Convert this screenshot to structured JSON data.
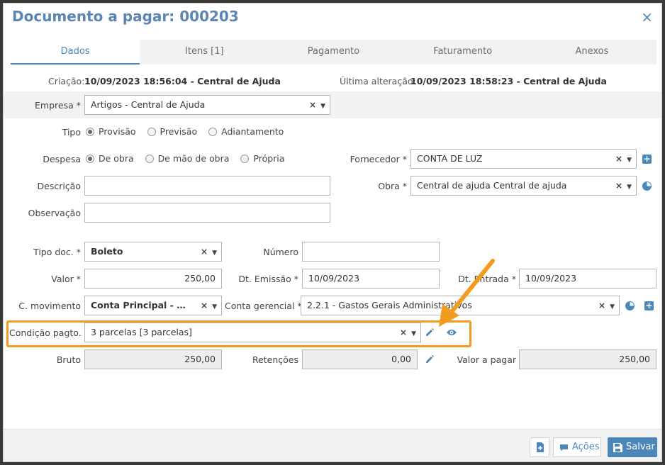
{
  "header": {
    "title": "Documento a pagar: 000203",
    "close_glyph": "×"
  },
  "tabs": [
    {
      "label": "Dados",
      "active": true
    },
    {
      "label": "Itens [1]"
    },
    {
      "label": "Pagamento"
    },
    {
      "label": "Faturamento"
    },
    {
      "label": "Anexos"
    }
  ],
  "meta": {
    "creation_label": "Criação:",
    "creation_value": "10/09/2023 18:56:04 - Central de Ajuda",
    "lastmod_label": "Última alteração:",
    "lastmod_value": "10/09/2023 18:58:23 - Central de Ajuda"
  },
  "form": {
    "empresa": {
      "label": "Empresa *",
      "value": "Artigos - Central de Ajuda"
    },
    "tipo": {
      "label": "Tipo",
      "options": [
        "Provisão",
        "Previsão",
        "Adiantamento"
      ],
      "selected": "Provisão"
    },
    "despesa": {
      "label": "Despesa",
      "options": [
        "De obra",
        "De mão de obra",
        "Própria"
      ],
      "selected": "De obra"
    },
    "fornecedor": {
      "label": "Fornecedor *",
      "value": "CONTA DE LUZ"
    },
    "descricao": {
      "label": "Descrição",
      "value": ""
    },
    "obra": {
      "label": "Obra *",
      "value": "Central de ajuda Central de ajuda"
    },
    "observacao": {
      "label": "Observação",
      "value": ""
    },
    "tipo_doc": {
      "label": "Tipo doc. *",
      "value": "Boleto"
    },
    "numero": {
      "label": "Número",
      "value": ""
    },
    "valor": {
      "label": "Valor *",
      "value": "250,00"
    },
    "dt_emissao": {
      "label": "Dt. Emissão *",
      "value": "10/09/2023"
    },
    "dt_entrada": {
      "label": "Dt. Entrada *",
      "value": "10/09/2023"
    },
    "c_movimento": {
      "label": "C. movimento",
      "value": "Conta Principal - Artigos - Central de Ajuda"
    },
    "conta_gerencial": {
      "label": "Conta gerencial *",
      "value": "2.2.1 - Gastos Gerais Administrativos"
    },
    "condicao_pagto": {
      "label": "Condição pagto. *",
      "value": "3 parcelas [3 parcelas]"
    },
    "bruto": {
      "label": "Bruto",
      "value": "250,00"
    },
    "retencoes": {
      "label": "Retenções",
      "value": "0,00"
    },
    "valor_a_pagar": {
      "label": "Valor a pagar",
      "value": "250,00"
    }
  },
  "controls": {
    "clear_glyph": "×",
    "caret_glyph": "▼"
  },
  "footer": {
    "acoes_label": "Ações",
    "salvar_label": "Salvar"
  },
  "colors": {
    "accent": "#4b87b9",
    "highlight": "#f29b1f"
  },
  "icons": [
    "close-icon",
    "plus-icon",
    "pie-chart-icon",
    "pencil-icon",
    "eye-icon",
    "document-add-icon",
    "comment-icon",
    "save-icon"
  ]
}
